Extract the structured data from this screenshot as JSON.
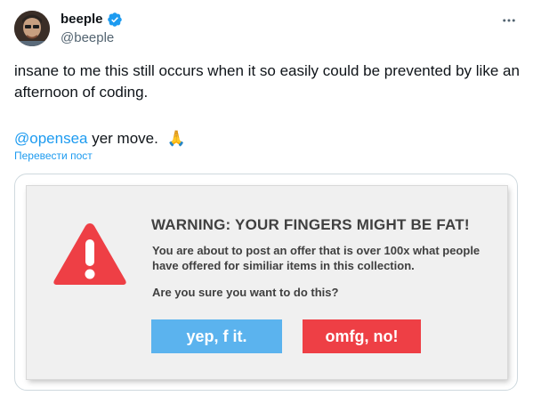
{
  "author": {
    "display_name": "beeple",
    "handle": "@beeple",
    "verified": true,
    "avatar_icon": "avatar-photo",
    "verified_icon": "verified-badge-icon"
  },
  "more_icon": "more-horizontal-icon",
  "tweet": {
    "text": "insane to me this still occurs when it so easily could be prevented by like an afternoon of coding.",
    "mention": "@opensea",
    "after_mention": " yer move.",
    "emoji": "🙏",
    "translate_label": "Перевести пост"
  },
  "media": {
    "warning_title": "WARNING: YOUR FINGERS MIGHT BE FAT!",
    "warning_body": "You are about to post an offer that is over 100x what people have offered for similiar items in this collection.",
    "warning_question": "Are you sure you want to do this?",
    "yes_button": "yep, f it.",
    "no_button": "omfg, no!",
    "warning_icon": "warning-triangle-icon"
  },
  "colors": {
    "link": "#1d9bf0",
    "secondary_text": "#536471",
    "warning_red": "#ee3f45",
    "yes_blue": "#5bb3ee",
    "dialog_bg": "#f0f0f0"
  }
}
